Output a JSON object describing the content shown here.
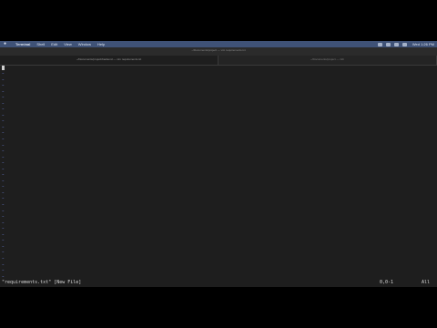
{
  "menubar": {
    "app": "Terminal",
    "items": [
      "Shell",
      "Edit",
      "View",
      "Window",
      "Help"
    ],
    "clock": "Wed 1:26 PM",
    "icons": [
      "wifi-icon",
      "battery-icon",
      "search-icon",
      "control-center-icon"
    ]
  },
  "window": {
    "title": "~/Documents/project — vim requirements.txt",
    "tabs": [
      {
        "label": "~/Documents/project/backend — vim requirements.txt",
        "active": true
      },
      {
        "label": "~/Documents/project — zsh",
        "active": false
      }
    ]
  },
  "buffer": {
    "tilde": "~",
    "tilde_count": 36
  },
  "status": {
    "message": "\"requirements.txt\" [New File]",
    "position": "0,0-1",
    "scroll": "All"
  },
  "colors": {
    "background": "#1e1e1e",
    "tilde": "#5f6fb6",
    "menubar": "#3f5277"
  }
}
